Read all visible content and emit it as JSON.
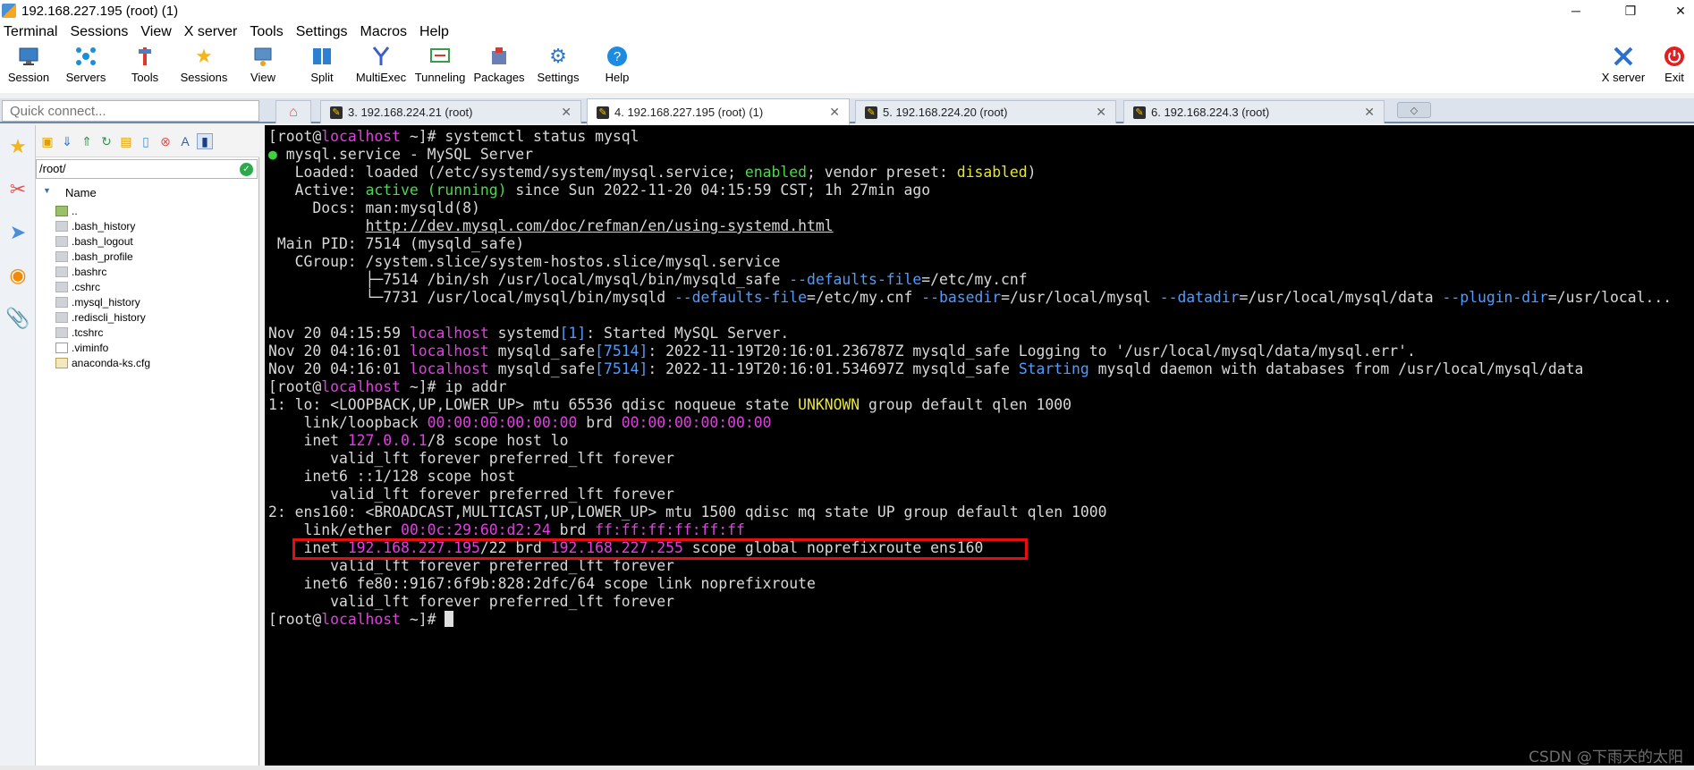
{
  "window": {
    "title": "192.168.227.195 (root) (1)"
  },
  "menu": [
    "Terminal",
    "Sessions",
    "View",
    "X server",
    "Tools",
    "Settings",
    "Macros",
    "Help"
  ],
  "toolbar": [
    {
      "label": "Session",
      "icon": "monitor-icon",
      "color": "#3b7fc4"
    },
    {
      "label": "Servers",
      "icon": "servers-icon",
      "color": "#1a8fd6"
    },
    {
      "label": "Tools",
      "icon": "tools-icon",
      "color": "#d93a2b"
    },
    {
      "label": "Sessions",
      "icon": "star-icon",
      "color": "#f2b51c"
    },
    {
      "label": "View",
      "icon": "view-icon",
      "color": "#5a8fc8"
    },
    {
      "label": "Split",
      "icon": "split-icon",
      "color": "#2c7fd1"
    },
    {
      "label": "MultiExec",
      "icon": "multiexec-icon",
      "color": "#3c5fc4"
    },
    {
      "label": "Tunneling",
      "icon": "tunneling-icon",
      "color": "#3a9c48"
    },
    {
      "label": "Packages",
      "icon": "packages-icon",
      "color": "#6a7fb5"
    },
    {
      "label": "Settings",
      "icon": "gears-icon",
      "color": "#2a78c8"
    },
    {
      "label": "Help",
      "icon": "help-icon",
      "color": "#1d8be0"
    }
  ],
  "toolbar_right": [
    {
      "label": "X server",
      "icon": "x-server-icon",
      "color": "#2d6fcc"
    },
    {
      "label": "Exit",
      "icon": "power-icon",
      "color": "#e02020"
    }
  ],
  "quick_connect": {
    "placeholder": "Quick connect..."
  },
  "tabs": [
    {
      "label": "3. 192.168.224.21 (root)",
      "active": false
    },
    {
      "label": "4. 192.168.227.195 (root) (1)",
      "active": true
    },
    {
      "label": "5. 192.168.224.20 (root)",
      "active": false
    },
    {
      "label": "6. 192.168.224.3 (root)",
      "active": false
    }
  ],
  "sftp": {
    "path": "/root/",
    "column_name": "Name",
    "files": [
      {
        "name": "..",
        "type": "folder"
      },
      {
        "name": ".bash_history",
        "type": "file"
      },
      {
        "name": ".bash_logout",
        "type": "file"
      },
      {
        "name": ".bash_profile",
        "type": "file"
      },
      {
        "name": ".bashrc",
        "type": "file"
      },
      {
        "name": ".cshrc",
        "type": "file"
      },
      {
        "name": ".mysql_history",
        "type": "file"
      },
      {
        "name": ".rediscli_history",
        "type": "file"
      },
      {
        "name": ".tcshrc",
        "type": "file"
      },
      {
        "name": ".viminfo",
        "type": "doc"
      },
      {
        "name": "anaconda-ks.cfg",
        "type": "cfg"
      }
    ]
  },
  "terminal": {
    "lines": [
      [
        {
          "t": "[root@"
        },
        {
          "t": "localhost",
          "c": "m"
        },
        {
          "t": " ~]# systemctl status mysql"
        }
      ],
      [
        {
          "t": "●",
          "c": "dot"
        },
        {
          "t": " mysql.service - MySQL Server"
        }
      ],
      [
        {
          "t": "   Loaded: loaded (/etc/systemd/system/mysql.service; "
        },
        {
          "t": "enabled",
          "c": "g"
        },
        {
          "t": "; vendor preset: "
        },
        {
          "t": "disabled",
          "c": "y"
        },
        {
          "t": ")"
        }
      ],
      [
        {
          "t": "   Active: "
        },
        {
          "t": "active (running)",
          "c": "g"
        },
        {
          "t": " since Sun 2022-11-20 04:15:59 CST; 1h 27min ago"
        }
      ],
      [
        {
          "t": "     Docs: man:mysqld(8)"
        }
      ],
      [
        {
          "t": "           "
        },
        {
          "t": "http://dev.mysql.com/doc/refman/en/using-systemd.html",
          "c": "u"
        }
      ],
      [
        {
          "t": " Main PID: 7514 (mysqld_safe)"
        }
      ],
      [
        {
          "t": "   CGroup: /system.slice/system-hostos.slice/mysql.service"
        }
      ],
      [
        {
          "t": "           ├─7514 /bin/sh /usr/local/mysql/bin/mysqld_safe "
        },
        {
          "t": "--defaults-file",
          "c": "b"
        },
        {
          "t": "=/etc/my.cnf"
        }
      ],
      [
        {
          "t": "           └─7731 /usr/local/mysql/bin/mysqld "
        },
        {
          "t": "--defaults-file",
          "c": "b"
        },
        {
          "t": "=/etc/my.cnf "
        },
        {
          "t": "--basedir",
          "c": "b"
        },
        {
          "t": "=/usr/local/mysql "
        },
        {
          "t": "--datadir",
          "c": "b"
        },
        {
          "t": "=/usr/local/mysql/data "
        },
        {
          "t": "--plugin-dir",
          "c": "b"
        },
        {
          "t": "=/usr/local..."
        }
      ],
      [
        {
          "t": ""
        }
      ],
      [
        {
          "t": "Nov 20 04:15:59 "
        },
        {
          "t": "localhost",
          "c": "m"
        },
        {
          "t": " systemd"
        },
        {
          "t": "[1]",
          "c": "b"
        },
        {
          "t": ": Started MySQL Server."
        }
      ],
      [
        {
          "t": "Nov 20 04:16:01 "
        },
        {
          "t": "localhost",
          "c": "m"
        },
        {
          "t": " mysqld_safe"
        },
        {
          "t": "[7514]",
          "c": "b"
        },
        {
          "t": ": 2022-11-19T20:16:01.236787Z mysqld_safe Logging to '/usr/local/mysql/data/mysql.err'."
        }
      ],
      [
        {
          "t": "Nov 20 04:16:01 "
        },
        {
          "t": "localhost",
          "c": "m"
        },
        {
          "t": " mysqld_safe"
        },
        {
          "t": "[7514]",
          "c": "b"
        },
        {
          "t": ": 2022-11-19T20:16:01.534697Z mysqld_safe "
        },
        {
          "t": "Starting",
          "c": "b"
        },
        {
          "t": " mysqld daemon with databases from /usr/local/mysql/data"
        }
      ],
      [
        {
          "t": "[root@"
        },
        {
          "t": "localhost",
          "c": "m"
        },
        {
          "t": " ~]# ip addr"
        }
      ],
      [
        {
          "t": "1: lo: <LOOPBACK,UP,LOWER_UP> mtu 65536 qdisc noqueue state "
        },
        {
          "t": "UNKNOWN",
          "c": "y"
        },
        {
          "t": " group default qlen 1000"
        }
      ],
      [
        {
          "t": "    link/loopback "
        },
        {
          "t": "00:00:00:00:00:00",
          "c": "m"
        },
        {
          "t": " brd "
        },
        {
          "t": "00:00:00:00:00:00",
          "c": "m"
        }
      ],
      [
        {
          "t": "    inet "
        },
        {
          "t": "127.0.0.1",
          "c": "m"
        },
        {
          "t": "/8 scope host lo"
        }
      ],
      [
        {
          "t": "       valid_lft forever preferred_lft forever"
        }
      ],
      [
        {
          "t": "    inet6 ::1/128 scope host"
        }
      ],
      [
        {
          "t": "       valid_lft forever preferred_lft forever"
        }
      ],
      [
        {
          "t": "2: ens160: <BROADCAST,MULTICAST,UP,LOWER_UP> mtu 1500 qdisc mq state UP group default qlen 1000"
        }
      ],
      [
        {
          "t": "    link/ether "
        },
        {
          "t": "00:0c:29:60:d2:24",
          "c": "m"
        },
        {
          "t": " brd "
        },
        {
          "t": "ff:ff:ff:ff:ff:ff",
          "c": "m"
        }
      ],
      [
        {
          "t": "    inet "
        },
        {
          "t": "192.168.227.195",
          "c": "m"
        },
        {
          "t": "/22 brd "
        },
        {
          "t": "192.168.227.255",
          "c": "m"
        },
        {
          "t": " scope global noprefixroute ens160"
        }
      ],
      [
        {
          "t": "       valid_lft forever preferred_lft forever"
        }
      ],
      [
        {
          "t": "    inet6 fe80::9167:6f9b:828:2dfc/64 scope link noprefixroute"
        }
      ],
      [
        {
          "t": "       valid_lft forever preferred_lft forever"
        }
      ],
      [
        {
          "t": "[root@"
        },
        {
          "t": "localhost",
          "c": "m"
        },
        {
          "t": " ~]# "
        }
      ]
    ]
  },
  "watermark": "CSDN @下雨天的太阳"
}
